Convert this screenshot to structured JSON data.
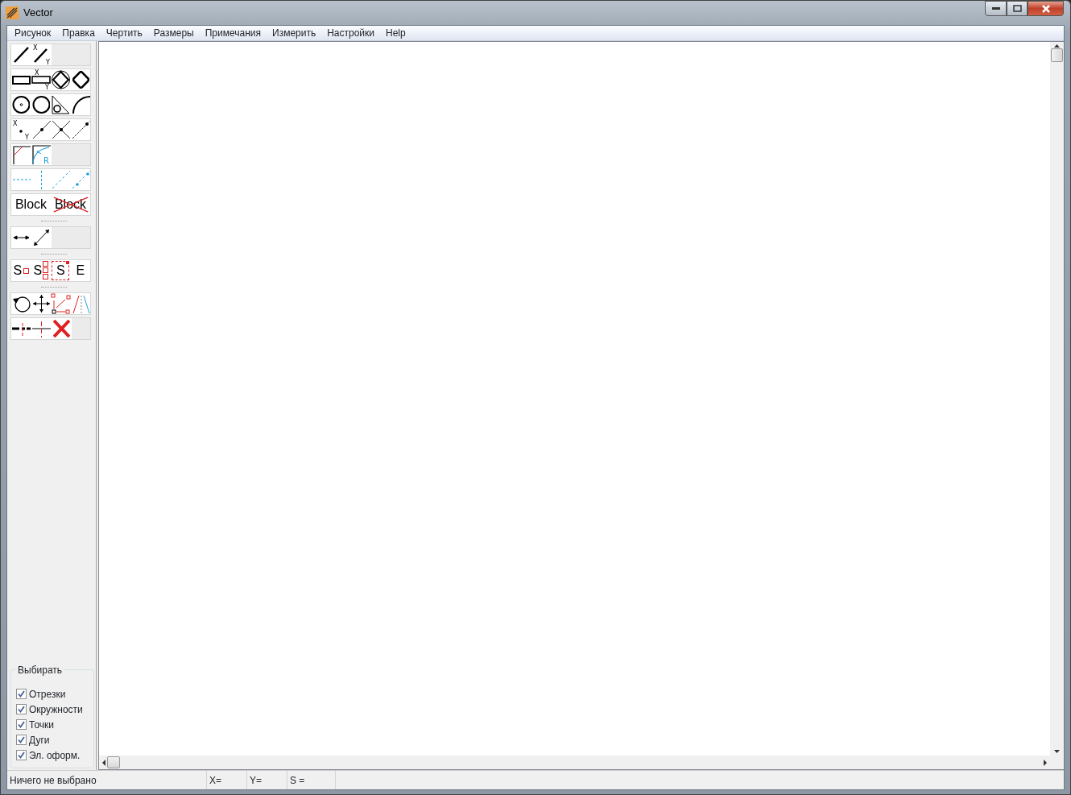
{
  "window": {
    "title": "Vector"
  },
  "menu": [
    "Рисунок",
    "Правка",
    "Чертить",
    "Размеры",
    "Примечания",
    "Измерить",
    "Настройки",
    "Help"
  ],
  "toolbars": [
    {
      "rows": [
        [
          {
            "kind": "line"
          },
          {
            "kind": "line-xy",
            "labels": [
              "X",
              "Y"
            ]
          }
        ],
        [
          {
            "kind": "rect"
          },
          {
            "kind": "rect-xy",
            "labels": [
              "X",
              "Y"
            ]
          },
          {
            "kind": "diamond-circle"
          },
          {
            "kind": "diamond-rounded"
          }
        ],
        [
          {
            "kind": "circle-center"
          },
          {
            "kind": "circle"
          },
          {
            "kind": "triangle-circle"
          },
          {
            "kind": "arc"
          }
        ],
        [
          {
            "kind": "point-xy",
            "labels": [
              "X",
              "Y"
            ]
          },
          {
            "kind": "point-on-line"
          },
          {
            "kind": "intersection"
          },
          {
            "kind": "point-end"
          }
        ],
        [
          {
            "kind": "corner"
          },
          {
            "kind": "fillet",
            "labels": [
              "R"
            ]
          }
        ],
        [
          {
            "kind": "dash-h"
          },
          {
            "kind": "dash-v"
          },
          {
            "kind": "dash-diag"
          },
          {
            "kind": "dash-points"
          }
        ],
        [
          {
            "kind": "block",
            "text": "Block"
          },
          {
            "kind": "block-delete",
            "text": "Block"
          }
        ]
      ]
    },
    {
      "rows": [
        [
          {
            "kind": "arrow-h"
          },
          {
            "kind": "arrow-diag"
          }
        ]
      ]
    },
    {
      "rows": [
        [
          {
            "kind": "s-square",
            "text": "S"
          },
          {
            "kind": "s-stack",
            "text": "S"
          },
          {
            "kind": "s-select",
            "text": "S"
          },
          {
            "kind": "letter",
            "text": "E"
          }
        ]
      ]
    },
    {
      "rows": [
        [
          {
            "kind": "rotate"
          },
          {
            "kind": "move"
          },
          {
            "kind": "scale"
          },
          {
            "kind": "mirror"
          }
        ],
        [
          {
            "kind": "break"
          },
          {
            "kind": "cross"
          },
          {
            "kind": "delete"
          }
        ]
      ]
    }
  ],
  "select_group": {
    "title": "Выбирать",
    "options": [
      {
        "label": "Отрезки",
        "checked": true
      },
      {
        "label": "Окружности",
        "checked": true
      },
      {
        "label": "Точки",
        "checked": true
      },
      {
        "label": "Дуги",
        "checked": true
      },
      {
        "label": "Эл. оформ.",
        "checked": true
      }
    ]
  },
  "status_bar": [
    "Ничего не выбрано",
    "X=",
    "Y=",
    "S ="
  ]
}
